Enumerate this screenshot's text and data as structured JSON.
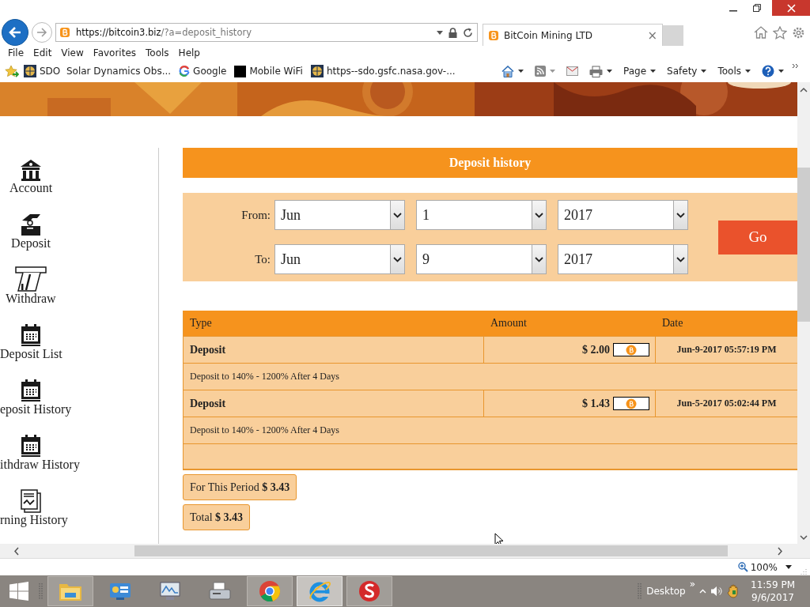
{
  "browser": {
    "address": {
      "domain": "https://bitcoin3.biz",
      "path": "/?a=deposit_history"
    },
    "tab": {
      "title": "BitCoin Mining LTD",
      "close": "×"
    },
    "menu": [
      "File",
      "Edit",
      "View",
      "Favorites",
      "Tools",
      "Help"
    ],
    "favorites": [
      {
        "kind": "globe",
        "label": "SDO  Solar Dynamics Obs..."
      },
      {
        "kind": "google",
        "label": "Google"
      },
      {
        "kind": "square",
        "label": "Mobile WiFi"
      },
      {
        "kind": "globe",
        "label": "https--sdo.gsfc.nasa.gov-..."
      }
    ],
    "commands": [
      "Page",
      "Safety",
      "Tools"
    ],
    "zoom": "100%"
  },
  "sidebar": {
    "items": [
      {
        "kind": "bank",
        "label": "Account"
      },
      {
        "kind": "deposit",
        "label": "Deposit"
      },
      {
        "kind": "card",
        "label": "Withdraw"
      },
      {
        "kind": "calendar",
        "label": "Deposit List"
      },
      {
        "kind": "calendar",
        "label": "eposit History"
      },
      {
        "kind": "calendar",
        "label": "ithdraw History"
      },
      {
        "kind": "report",
        "label": "rning History"
      }
    ]
  },
  "deposit_history": {
    "title": "Deposit history",
    "filter": {
      "from_label": "From:",
      "to_label": "To:",
      "from": [
        "Jun",
        "1",
        "2017"
      ],
      "to": [
        "Jun",
        "9",
        "2017"
      ],
      "go": "Go"
    },
    "table": {
      "columns": [
        "Type",
        "Amount",
        "Date"
      ],
      "rows": [
        {
          "type": "Deposit",
          "amount": "$ 2.00",
          "date": "Jun-9-2017 05:57:19 PM",
          "plan": "Deposit to 140% - 1200% After 4 Days"
        },
        {
          "type": "Deposit",
          "amount": "$ 1.43",
          "date": "Jun-5-2017 05:02:44 PM",
          "plan": "Deposit to 140% - 1200% After 4 Days"
        }
      ]
    },
    "period_total": "For This Period **$ 3.43**",
    "total": "Total **$ 3.43**"
  },
  "taskbar": {
    "apps": [
      {
        "kind": "explorer",
        "running": true,
        "selected": false
      },
      {
        "kind": "control",
        "running": false,
        "selected": false
      },
      {
        "kind": "monitor",
        "running": false,
        "selected": false
      },
      {
        "kind": "fax",
        "running": false,
        "selected": false
      },
      {
        "kind": "chrome",
        "running": true,
        "selected": false
      },
      {
        "kind": "ie",
        "running": true,
        "selected": true
      },
      {
        "kind": "sapp",
        "running": true,
        "selected": false
      }
    ],
    "toolbar": "Desktop",
    "more": "»",
    "time": "11:59 PM",
    "date": "9/6/2017"
  }
}
